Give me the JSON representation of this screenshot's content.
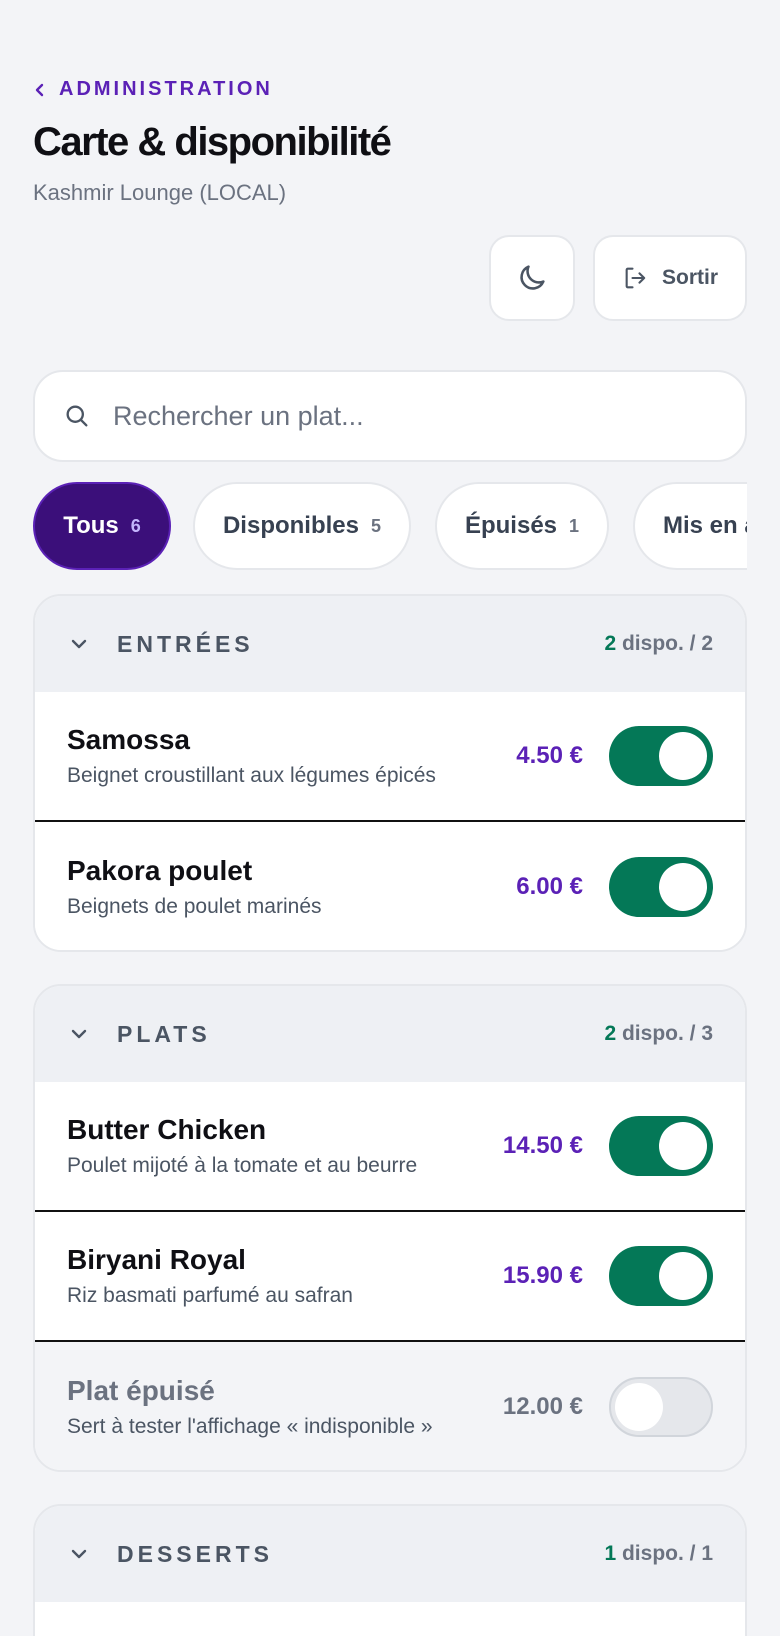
{
  "header": {
    "back_label": "ADMINISTRATION",
    "title": "Carte & disponibilité",
    "subtitle": "Kashmir Lounge (LOCAL)",
    "logout_label": "Sortir"
  },
  "search": {
    "placeholder": "Rechercher un plat..."
  },
  "filters": [
    {
      "label": "Tous",
      "count": "6",
      "active": true
    },
    {
      "label": "Disponibles",
      "count": "5"
    },
    {
      "label": "Épuisés",
      "count": "1"
    },
    {
      "label": "Mis en a",
      "count": ""
    }
  ],
  "sections": [
    {
      "title": "ENTRÉES",
      "available": "2",
      "count_suffix": "dispo. / 2",
      "items": [
        {
          "name": "Samossa",
          "desc": "Beignet croustillant aux légumes épicés",
          "price": "4.50 €",
          "available": true
        },
        {
          "name": "Pakora poulet",
          "desc": "Beignets de poulet marinés",
          "price": "6.00 €",
          "available": true
        }
      ]
    },
    {
      "title": "PLATS",
      "available": "2",
      "count_suffix": "dispo. / 3",
      "items": [
        {
          "name": "Butter Chicken",
          "desc": "Poulet mijoté à la tomate et au beurre",
          "price": "14.50 €",
          "available": true
        },
        {
          "name": "Biryani Royal",
          "desc": "Riz basmati parfumé au safran",
          "price": "15.90 €",
          "available": true
        },
        {
          "name": "Plat épuisé",
          "desc": "Sert à tester l'affichage « indisponible »",
          "price": "12.00 €",
          "available": false
        }
      ]
    },
    {
      "title": "DESSERTS",
      "available": "1",
      "count_suffix": "dispo. / 1",
      "items": []
    }
  ],
  "colors": {
    "accent": "#5b21b6",
    "active_chip": "#3b0f7a",
    "available": "#047857"
  }
}
